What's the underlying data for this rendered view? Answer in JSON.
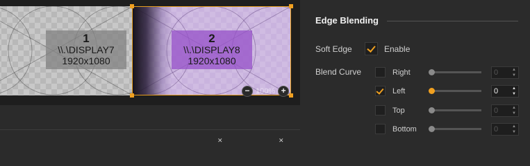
{
  "preview": {
    "displays": [
      {
        "number": "1",
        "name": "\\\\.\\DISPLAY7",
        "resolution": "1920x1080"
      },
      {
        "number": "2",
        "name": "\\\\.\\DISPLAY8",
        "resolution": "1920x1080"
      }
    ],
    "zoom": "100%",
    "zoom_out": "−",
    "zoom_in": "+"
  },
  "panel": {
    "title": "Edge Blending",
    "soft_edge_label": "Soft Edge",
    "enable_label": "Enable",
    "enable_checked": true,
    "blend_curve_label": "Blend Curve",
    "curves": [
      {
        "label": "Right",
        "checked": false,
        "value": "0",
        "enabled": false
      },
      {
        "label": "Left",
        "checked": true,
        "value": "0",
        "enabled": true
      },
      {
        "label": "Top",
        "checked": false,
        "value": "0",
        "enabled": false
      },
      {
        "label": "Bottom",
        "checked": false,
        "value": "0",
        "enabled": false
      }
    ]
  },
  "colors": {
    "accent": "#f0a020",
    "display2_tint": "#9b59d0"
  }
}
